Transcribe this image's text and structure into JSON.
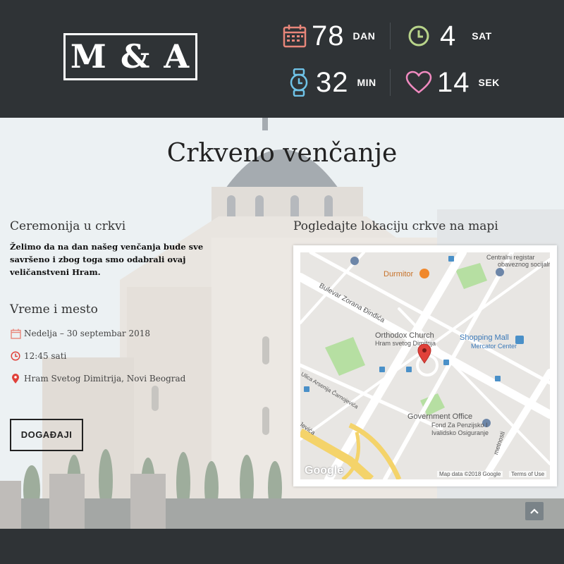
{
  "header": {
    "logo": "M & A",
    "countdown": [
      {
        "value": "78",
        "unit": "DAN",
        "icon": "calendar-icon",
        "color": "#e8867a"
      },
      {
        "value": "4",
        "unit": "SAT",
        "icon": "clock-icon",
        "color": "#b8d48a"
      },
      {
        "value": "32",
        "unit": "MIN",
        "icon": "watch-icon",
        "color": "#6fc3e8"
      },
      {
        "value": "14",
        "unit": "SEK",
        "icon": "heart-icon",
        "color": "#f08ac0"
      }
    ]
  },
  "main": {
    "title": "Crkveno venčanje",
    "ceremony_heading": "Ceremonija u crkvi",
    "ceremony_text": "Želimo da na dan našeg venčanja bude sve savršeno i zbog toga smo odabrali ovaj veličanstveni Hram.",
    "time_heading": "Vreme i mesto",
    "date": "Nedelja – 30 septembar 2018",
    "time": "12:45 sati",
    "place": "Hram Svetog Dimitrija, Novi Beograd",
    "button": "DOGAĐAJI",
    "map_heading": "Pogledajte lokaciju crkve na mapi"
  },
  "map": {
    "labels": {
      "centralni_top": "Centralni registar",
      "centralni_sub": "obaveznog socijalnog",
      "durmitor": "Durmitor",
      "bulevar": "Bulevar Zorana Đinđića",
      "church_name": "Orthodox Church",
      "church_sub": "Hram svetog Dimitrija",
      "mall": "Shopping Mall",
      "mall_sub": "Mercator Center",
      "arsenija": "Ulica Arsenija Čarnojevića",
      "gov": "Government Office",
      "gov_sub1": "Fond Za Penzijsko I",
      "gov_sub2": "Ivalidsko Osiguranje",
      "street_left": "Jevića",
      "street_right": "metnosti",
      "google": "Google",
      "map_data": "Map data ©2018 Google",
      "terms": "Terms of Use"
    }
  },
  "colors": {
    "header_bg": "#2f3336",
    "pin": "#e0413a",
    "park": "#b6dfa2"
  }
}
